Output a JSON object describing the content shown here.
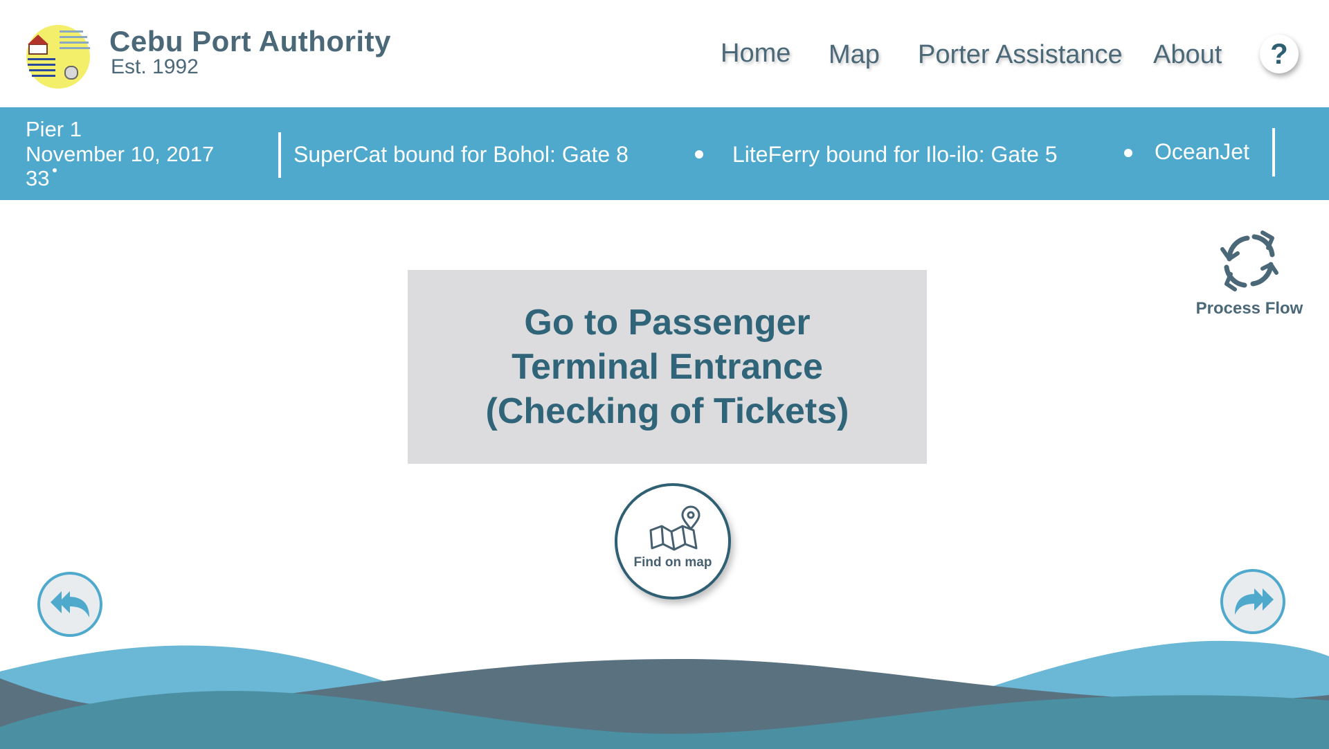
{
  "header": {
    "brand_title": "Cebu Port Authority",
    "brand_subtitle": "Est. 1992",
    "logo_icon": "port-authority-logo",
    "nav": {
      "home": "Home",
      "map": "Map",
      "porter": "Porter Assistance",
      "about": "About"
    },
    "help_label": "?"
  },
  "infobar": {
    "pier": "Pier 1",
    "date": "November 10, 2017",
    "temperature": "33",
    "ticker": [
      "SuperCat bound for Bohol: Gate 8",
      "LiteFerry bound for Ilo-ilo: Gate 5",
      "OceanJet"
    ]
  },
  "main": {
    "process_flow_label": "Process Flow",
    "step_lines": [
      "Go to Passenger",
      "Terminal Entrance",
      "(Checking of Tickets)"
    ],
    "find_on_map_label": "Find on map"
  },
  "colors": {
    "accent_blue": "#4ea9cd",
    "dark_teal": "#2f6479",
    "text_slate": "#4b6878",
    "card_gray": "#dcdcde",
    "wave_light": "#6ab7d6",
    "wave_slate": "#5a7280",
    "wave_teal": "#4a8fa2"
  }
}
